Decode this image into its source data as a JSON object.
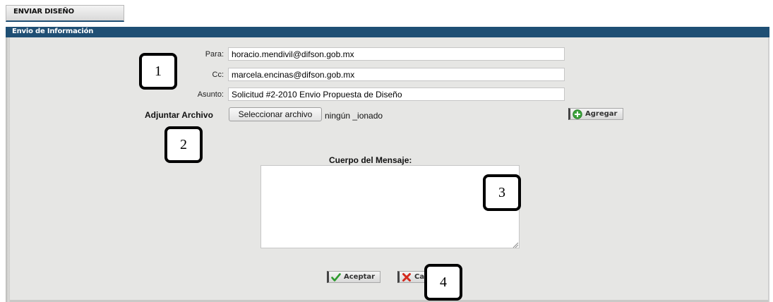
{
  "tab": {
    "label": "ENVIAR DISEÑO"
  },
  "panel": {
    "title": "Envio de Información"
  },
  "form": {
    "para": {
      "label": "Para:",
      "value": "horacio.mendivil@difson.gob.mx"
    },
    "cc": {
      "label": "Cc:",
      "value": "marcela.encinas@difson.gob.mx"
    },
    "asunto": {
      "label": "Asunto:",
      "value": "Solicitud #2-2010 Envio Propuesta de Diseño"
    },
    "attach": {
      "label": "Adjuntar Archivo",
      "button": "Seleccionar archivo",
      "status": "ningún _ionado"
    },
    "add_button": "Agregar",
    "body_label": "Cuerpo del Mensaje:",
    "body_value": ""
  },
  "actions": {
    "accept": "Aceptar",
    "cancel": "Ca"
  },
  "callouts": [
    "1",
    "2",
    "3",
    "4"
  ],
  "colors": {
    "header": "#1f4f74",
    "panel_bg": "#e6e6e4",
    "accept_icon": "#2e9b2e",
    "cancel_icon": "#d42a1e",
    "add_icon": "#3aa23a"
  },
  "icons": {
    "add": "plus-circle-icon",
    "accept": "checkmark-icon",
    "cancel": "x-mark-icon"
  }
}
